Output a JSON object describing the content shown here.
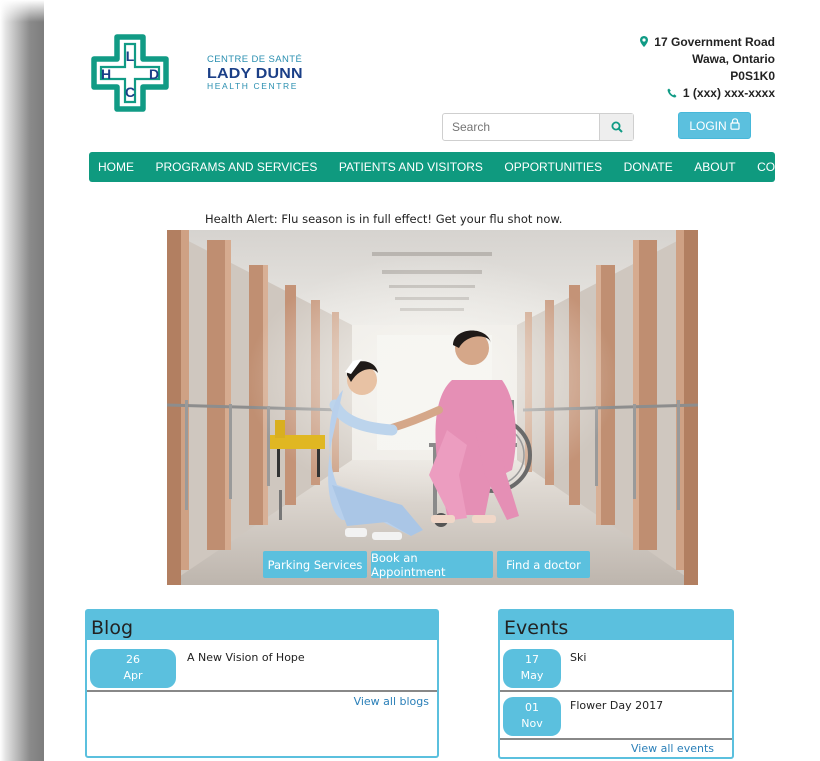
{
  "logo": {
    "letters": [
      "L",
      "H",
      "D",
      "C"
    ],
    "line1": "CENTRE DE SANTÉ",
    "line2": "LADY DUNN",
    "line3": "HEALTH CENTRE",
    "primary_color": "#119b85",
    "accent_color": "#1b3f87"
  },
  "contact": {
    "street": "17 Government Road",
    "city": "Wawa, Ontario",
    "postal": "P0S1K0",
    "phone": "1 (xxx) xxx-xxxx",
    "street_icon": "map-marker-icon",
    "phone_icon": "phone-icon"
  },
  "search": {
    "placeholder": "Search",
    "icon": "search-icon"
  },
  "login": {
    "label": "LOGIN",
    "icon": "lock-icon"
  },
  "nav": {
    "items": [
      "HOME",
      "PROGRAMS AND SERVICES",
      "PATIENTS AND VISITORS",
      "OPPORTUNITIES",
      "DONATE",
      "ABOUT",
      "CONTACT"
    ]
  },
  "alert": {
    "text": "Health Alert: Flu season is in full effect! Get your flu shot now."
  },
  "hero": {
    "buttons": [
      "Parking Services",
      "Book an Appointment",
      "Find a doctor"
    ]
  },
  "blog": {
    "title": "Blog",
    "posts": [
      {
        "day": "26",
        "month": "Apr",
        "title": "A New Vision of Hope"
      }
    ],
    "view_all": "View all blogs"
  },
  "events": {
    "title": "Events",
    "items": [
      {
        "day": "17",
        "month": "May",
        "title": "Ski"
      },
      {
        "day": "01",
        "month": "Nov",
        "title": "Flower Day 2017"
      }
    ],
    "view_all": "View all events"
  },
  "colors": {
    "nav_bg": "#0f9a7f",
    "accent_blue": "#5bc0de",
    "link": "#2a7fb8"
  }
}
